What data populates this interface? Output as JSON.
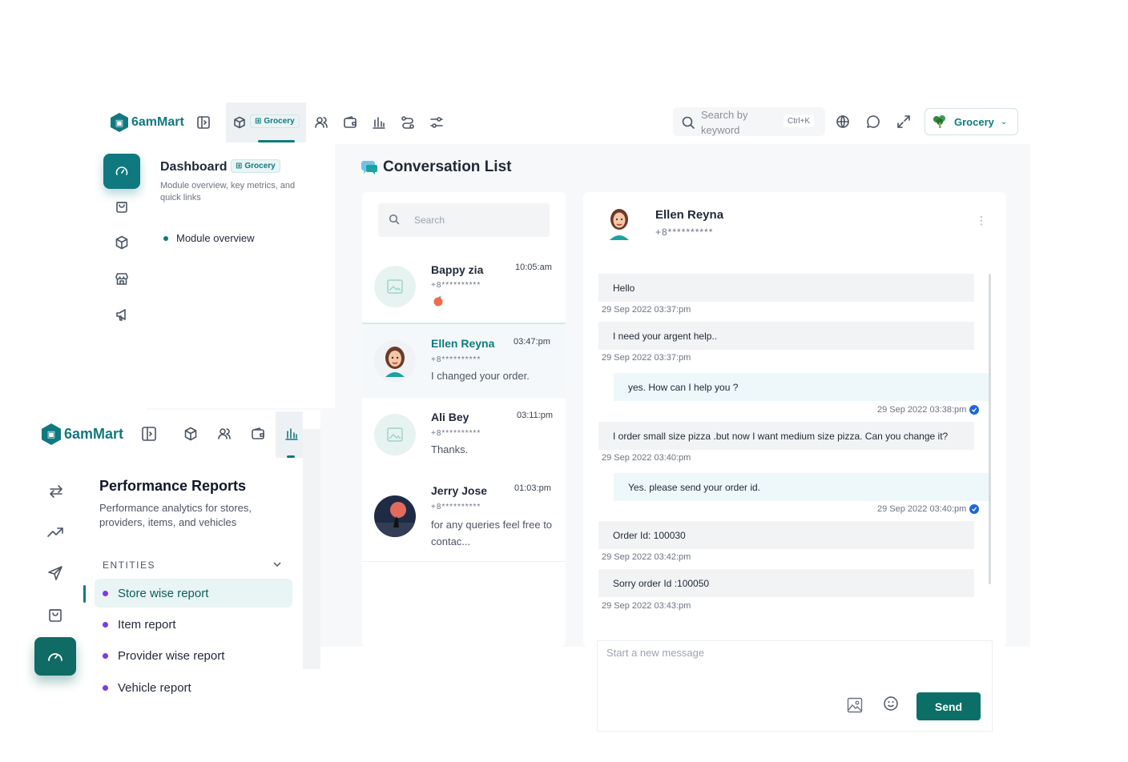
{
  "back_app": {
    "brand": "6amMart",
    "module_pill": "Grocery",
    "search": {
      "placeholder": "Search by keyword",
      "shortcut": "Ctrl+K"
    },
    "module_select": "Grocery",
    "dashboard": {
      "title": "Dashboard",
      "pill": "Grocery",
      "subtitle": "Module overview, key metrics, and quick links",
      "item": "Module overview"
    },
    "conversation": {
      "title": "Conversation List",
      "search_placeholder": "Search",
      "items": [
        {
          "name": "Bappy zia",
          "phone": "+8**********",
          "time": "10:05:am",
          "msg": ""
        },
        {
          "name": "Ellen Reyna",
          "phone": "+8**********",
          "time": "03:47:pm",
          "msg": "I changed your order."
        },
        {
          "name": "Ali Bey",
          "phone": "+8**********",
          "time": "03:11:pm",
          "msg": "Thanks."
        },
        {
          "name": "Jerry Jose",
          "phone": "+8**********",
          "time": "01:03:pm",
          "msg": "for any queries feel free to contac..."
        }
      ]
    },
    "chat": {
      "name": "Ellen Reyna",
      "phone": "+8**********",
      "messages": [
        {
          "text": "Hello",
          "time": "29 Sep 2022 03:37:pm",
          "me": false
        },
        {
          "text": "I need your argent help..",
          "time": "29 Sep 2022 03:37:pm",
          "me": false
        },
        {
          "text": "yes. How can I help you ?",
          "time": "29 Sep 2022 03:38:pm",
          "me": true
        },
        {
          "text": "I order small size pizza .but now I want medium size pizza. Can you change it?",
          "time": "29 Sep 2022 03:40:pm",
          "me": false
        },
        {
          "text": "Yes. please send your order id.",
          "time": "29 Sep 2022 03:40:pm",
          "me": true
        },
        {
          "text": "Order Id: 100030",
          "time": "29 Sep 2022 03:42:pm",
          "me": false
        },
        {
          "text": "Sorry order Id :100050",
          "time": "29 Sep 2022 03:43:pm",
          "me": false
        }
      ],
      "input_placeholder": "Start a new message",
      "send_label": "Send"
    }
  },
  "front_app": {
    "brand": "6amMart",
    "title": "Performance Reports",
    "subtitle": "Performance analytics for stores, providers, items, and vehicles",
    "section": "ENTITIES",
    "items": [
      "Store wise report",
      "Item report",
      "Provider wise report",
      "Vehicle report"
    ]
  },
  "colors": {
    "primary": "#107980",
    "accent_dot": "#7c3aed",
    "check": "#1e66d8"
  }
}
